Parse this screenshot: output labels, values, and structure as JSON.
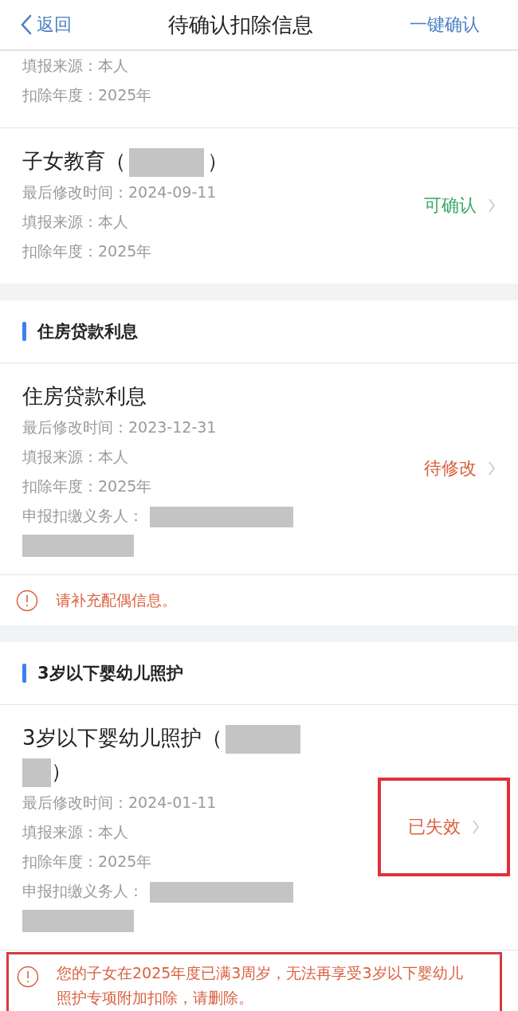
{
  "header": {
    "back": "返回",
    "title": "待确认扣除信息",
    "action": "一键确认"
  },
  "sections": [
    {
      "items": [
        {
          "fields": [
            {
              "label": "填报来源：",
              "value": "本人"
            },
            {
              "label": "扣除年度：",
              "value": "2025年"
            }
          ]
        },
        {
          "title_parts": [
            {
              "kind": "text",
              "text": "子女教育（"
            },
            {
              "kind": "redaction"
            },
            {
              "kind": "text",
              "text": "）"
            }
          ],
          "fields": [
            {
              "label": "最后修改时间：",
              "value": "2024-09-11"
            },
            {
              "label": "填报来源：",
              "value": "本人"
            },
            {
              "label": "扣除年度：",
              "value": "2025年"
            }
          ],
          "status": {
            "text": "可确认",
            "kind": "confirmable",
            "highlighted": false
          }
        }
      ]
    },
    {
      "heading": "住房贷款利息",
      "items": [
        {
          "title_parts": [
            {
              "kind": "text",
              "text": "住房贷款利息"
            }
          ],
          "fields": [
            {
              "label": "最后修改时间：",
              "value": "2023-12-31"
            },
            {
              "label": "填报来源：",
              "value": "本人"
            },
            {
              "label": "扣除年度：",
              "value": "2025年"
            },
            {
              "label": "申报扣缴义务人：",
              "kind": "redacted"
            }
          ],
          "status": {
            "text": "待修改",
            "kind": "needs_edit",
            "highlighted": false
          }
        }
      ],
      "warning": {
        "text": "请补充配偶信息。",
        "highlighted": false
      }
    },
    {
      "heading": "3岁以下婴幼儿照护",
      "items": [
        {
          "title_parts": [
            {
              "kind": "text",
              "text": "3岁以下婴幼儿照护（"
            },
            {
              "kind": "redaction"
            },
            {
              "kind": "redaction_short"
            },
            {
              "kind": "text",
              "text": "）"
            }
          ],
          "fields": [
            {
              "label": "最后修改时间：",
              "value": "2024-01-11"
            },
            {
              "label": "填报来源：",
              "value": "本人"
            },
            {
              "label": "扣除年度：",
              "value": "2025年"
            },
            {
              "label": "申报扣缴义务人：",
              "kind": "redacted"
            }
          ],
          "status": {
            "text": "已失效",
            "kind": "expired",
            "highlighted": true
          }
        }
      ],
      "warning": {
        "text": "您的子女在2025年度已满3周岁，无法再享受3岁以下婴幼儿照护专项附加扣除，请删除。",
        "highlighted": true
      }
    }
  ]
}
